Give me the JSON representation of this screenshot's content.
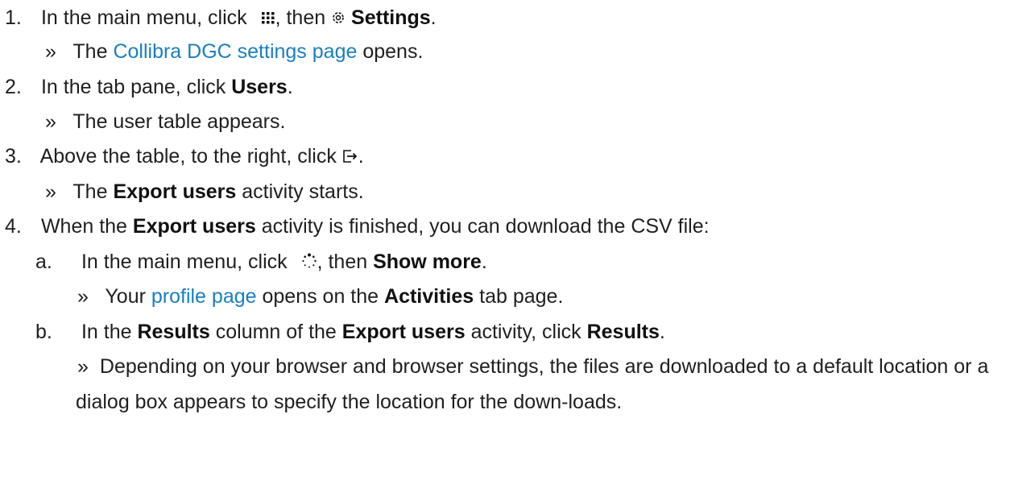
{
  "colors": {
    "text": "#1f1f1f",
    "link": "#1a7fc1",
    "background": "#ffffff"
  },
  "steps": {
    "s1": {
      "num": "1.",
      "text_a": "In the main menu, click",
      "icon": "apps-grid-icon",
      "text_b": ", then",
      "icon2": "gear-icon",
      "bold": "Settings",
      "text_c": ".",
      "result_prefix": "The",
      "result_link": "Collibra DGC settings page",
      "result_suffix": "opens."
    },
    "s2": {
      "num": "2.",
      "text_a": "In the tab pane, click",
      "bold": "Users",
      "text_b": ".",
      "result": "The user table appears."
    },
    "s3": {
      "num": "3.",
      "text_a": "Above the table, to the right, click",
      "icon": "export-icon",
      "text_b": ".",
      "result_prefix": "The",
      "result_bold": "Export users",
      "result_suffix": "activity starts."
    },
    "s4": {
      "num": "4.",
      "text_a": "When the",
      "bold": "Export users",
      "text_b": "activity is finished, you can download the CSV file:",
      "a": {
        "letter": "a.",
        "text_a": "In the main menu, click",
        "icon": "activity-spinner-icon",
        "text_b": ", then",
        "bold": "Show more",
        "text_c": ".",
        "result_prefix": "Your",
        "result_link": "profile page",
        "result_mid": "opens on the",
        "result_bold": "Activities",
        "result_suffix": "tab page."
      },
      "b": {
        "letter": "b.",
        "text_a": "In the",
        "bold1": "Results",
        "text_b": "column of the",
        "bold2": "Export users",
        "text_c": "activity, click",
        "bold3": "Results",
        "text_d": ".",
        "result": "Depending on your browser and browser settings, the files are downloaded to a default location or a dialog box appears to specify the location for the down-loads."
      }
    }
  }
}
